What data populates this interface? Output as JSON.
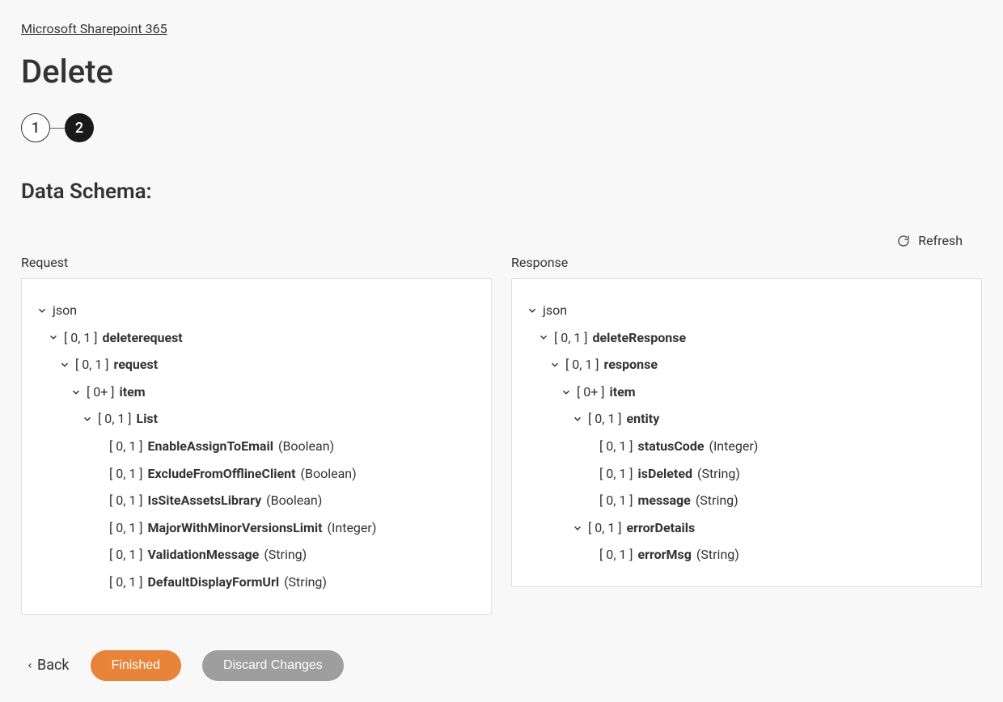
{
  "breadcrumb": "Microsoft Sharepoint 365",
  "page_title": "Delete",
  "stepper": {
    "step1": "1",
    "step2": "2"
  },
  "section_title": "Data Schema:",
  "refresh_label": "Refresh",
  "columns": {
    "request_label": "Request",
    "response_label": "Response"
  },
  "request_tree": {
    "root": "json",
    "n1_card": "[ 0, 1 ] ",
    "n1_name": "deleterequest",
    "n2_card": "[ 0, 1 ] ",
    "n2_name": "request",
    "n3_card": "[ 0+ ] ",
    "n3_name": "item",
    "n4_card": "[ 0, 1 ] ",
    "n4_name": "List",
    "l1_card": "[ 0, 1 ] ",
    "l1_name": "EnableAssignToEmail",
    "l1_type": " (Boolean)",
    "l2_card": "[ 0, 1 ] ",
    "l2_name": "ExcludeFromOfflineClient",
    "l2_type": " (Boolean)",
    "l3_card": "[ 0, 1 ] ",
    "l3_name": "IsSiteAssetsLibrary",
    "l3_type": " (Boolean)",
    "l4_card": "[ 0, 1 ] ",
    "l4_name": "MajorWithMinorVersionsLimit",
    "l4_type": " (Integer)",
    "l5_card": "[ 0, 1 ] ",
    "l5_name": "ValidationMessage",
    "l5_type": " (String)",
    "l6_card": "[ 0, 1 ] ",
    "l6_name": "DefaultDisplayFormUrl",
    "l6_type": " (String)"
  },
  "response_tree": {
    "root": "json",
    "n1_card": "[ 0, 1 ] ",
    "n1_name": "deleteResponse",
    "n2_card": "[ 0, 1 ] ",
    "n2_name": "response",
    "n3_card": "[ 0+ ] ",
    "n3_name": "item",
    "n4_card": "[ 0, 1 ] ",
    "n4_name": "entity",
    "l1_card": "[ 0, 1 ] ",
    "l1_name": "statusCode",
    "l1_type": " (Integer)",
    "l2_card": "[ 0, 1 ] ",
    "l2_name": "isDeleted",
    "l2_type": " (String)",
    "l3_card": "[ 0, 1 ] ",
    "l3_name": "message",
    "l3_type": " (String)",
    "n5_card": "[ 0, 1 ] ",
    "n5_name": "errorDetails",
    "l4_card": "[ 0, 1 ] ",
    "l4_name": "errorMsg",
    "l4_type": " (String)"
  },
  "footer": {
    "back": "Back",
    "finished": "Finished",
    "discard": "Discard Changes"
  }
}
